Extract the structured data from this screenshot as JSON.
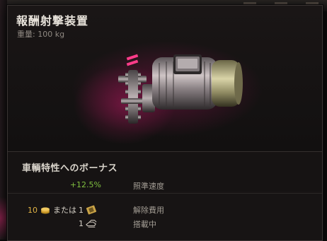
{
  "tooltip": {
    "title": "報酬射撃装置",
    "weight_label": "重量:",
    "weight_value": "100",
    "weight_unit": "kg"
  },
  "module": {
    "icon": "turbine-module-icon",
    "glow_color": "#c8206e",
    "marker_color": "#ff3c8a"
  },
  "bonus": {
    "heading": "車輌特性へのボーナス",
    "items": [
      {
        "value": "+12.5%",
        "label": "照準速度",
        "color": "#7fbf3f"
      }
    ]
  },
  "costs": {
    "demount_gold_amount": "10",
    "demount_or": "または",
    "demount_kit_amount": "1",
    "demount_label": "解除費用",
    "installed_count": "1",
    "installed_label": "搭載中",
    "gold_icon": "gold-coins-icon",
    "kit_icon": "demount-kit-icon",
    "installed_icon": "vehicles-icon"
  }
}
